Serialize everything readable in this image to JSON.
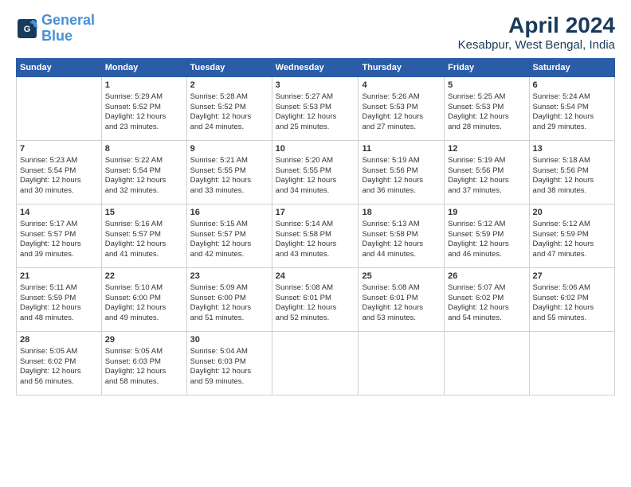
{
  "header": {
    "logo_line1": "General",
    "logo_line2": "Blue",
    "title": "April 2024",
    "subtitle": "Kesabpur, West Bengal, India"
  },
  "days_of_week": [
    "Sunday",
    "Monday",
    "Tuesday",
    "Wednesday",
    "Thursday",
    "Friday",
    "Saturday"
  ],
  "weeks": [
    [
      {
        "day": "",
        "detail": ""
      },
      {
        "day": "1",
        "detail": "Sunrise: 5:29 AM\nSunset: 5:52 PM\nDaylight: 12 hours\nand 23 minutes."
      },
      {
        "day": "2",
        "detail": "Sunrise: 5:28 AM\nSunset: 5:52 PM\nDaylight: 12 hours\nand 24 minutes."
      },
      {
        "day": "3",
        "detail": "Sunrise: 5:27 AM\nSunset: 5:53 PM\nDaylight: 12 hours\nand 25 minutes."
      },
      {
        "day": "4",
        "detail": "Sunrise: 5:26 AM\nSunset: 5:53 PM\nDaylight: 12 hours\nand 27 minutes."
      },
      {
        "day": "5",
        "detail": "Sunrise: 5:25 AM\nSunset: 5:53 PM\nDaylight: 12 hours\nand 28 minutes."
      },
      {
        "day": "6",
        "detail": "Sunrise: 5:24 AM\nSunset: 5:54 PM\nDaylight: 12 hours\nand 29 minutes."
      }
    ],
    [
      {
        "day": "7",
        "detail": "Sunrise: 5:23 AM\nSunset: 5:54 PM\nDaylight: 12 hours\nand 30 minutes."
      },
      {
        "day": "8",
        "detail": "Sunrise: 5:22 AM\nSunset: 5:54 PM\nDaylight: 12 hours\nand 32 minutes."
      },
      {
        "day": "9",
        "detail": "Sunrise: 5:21 AM\nSunset: 5:55 PM\nDaylight: 12 hours\nand 33 minutes."
      },
      {
        "day": "10",
        "detail": "Sunrise: 5:20 AM\nSunset: 5:55 PM\nDaylight: 12 hours\nand 34 minutes."
      },
      {
        "day": "11",
        "detail": "Sunrise: 5:19 AM\nSunset: 5:56 PM\nDaylight: 12 hours\nand 36 minutes."
      },
      {
        "day": "12",
        "detail": "Sunrise: 5:19 AM\nSunset: 5:56 PM\nDaylight: 12 hours\nand 37 minutes."
      },
      {
        "day": "13",
        "detail": "Sunrise: 5:18 AM\nSunset: 5:56 PM\nDaylight: 12 hours\nand 38 minutes."
      }
    ],
    [
      {
        "day": "14",
        "detail": "Sunrise: 5:17 AM\nSunset: 5:57 PM\nDaylight: 12 hours\nand 39 minutes."
      },
      {
        "day": "15",
        "detail": "Sunrise: 5:16 AM\nSunset: 5:57 PM\nDaylight: 12 hours\nand 41 minutes."
      },
      {
        "day": "16",
        "detail": "Sunrise: 5:15 AM\nSunset: 5:57 PM\nDaylight: 12 hours\nand 42 minutes."
      },
      {
        "day": "17",
        "detail": "Sunrise: 5:14 AM\nSunset: 5:58 PM\nDaylight: 12 hours\nand 43 minutes."
      },
      {
        "day": "18",
        "detail": "Sunrise: 5:13 AM\nSunset: 5:58 PM\nDaylight: 12 hours\nand 44 minutes."
      },
      {
        "day": "19",
        "detail": "Sunrise: 5:12 AM\nSunset: 5:59 PM\nDaylight: 12 hours\nand 46 minutes."
      },
      {
        "day": "20",
        "detail": "Sunrise: 5:12 AM\nSunset: 5:59 PM\nDaylight: 12 hours\nand 47 minutes."
      }
    ],
    [
      {
        "day": "21",
        "detail": "Sunrise: 5:11 AM\nSunset: 5:59 PM\nDaylight: 12 hours\nand 48 minutes."
      },
      {
        "day": "22",
        "detail": "Sunrise: 5:10 AM\nSunset: 6:00 PM\nDaylight: 12 hours\nand 49 minutes."
      },
      {
        "day": "23",
        "detail": "Sunrise: 5:09 AM\nSunset: 6:00 PM\nDaylight: 12 hours\nand 51 minutes."
      },
      {
        "day": "24",
        "detail": "Sunrise: 5:08 AM\nSunset: 6:01 PM\nDaylight: 12 hours\nand 52 minutes."
      },
      {
        "day": "25",
        "detail": "Sunrise: 5:08 AM\nSunset: 6:01 PM\nDaylight: 12 hours\nand 53 minutes."
      },
      {
        "day": "26",
        "detail": "Sunrise: 5:07 AM\nSunset: 6:02 PM\nDaylight: 12 hours\nand 54 minutes."
      },
      {
        "day": "27",
        "detail": "Sunrise: 5:06 AM\nSunset: 6:02 PM\nDaylight: 12 hours\nand 55 minutes."
      }
    ],
    [
      {
        "day": "28",
        "detail": "Sunrise: 5:05 AM\nSunset: 6:02 PM\nDaylight: 12 hours\nand 56 minutes."
      },
      {
        "day": "29",
        "detail": "Sunrise: 5:05 AM\nSunset: 6:03 PM\nDaylight: 12 hours\nand 58 minutes."
      },
      {
        "day": "30",
        "detail": "Sunrise: 5:04 AM\nSunset: 6:03 PM\nDaylight: 12 hours\nand 59 minutes."
      },
      {
        "day": "",
        "detail": ""
      },
      {
        "day": "",
        "detail": ""
      },
      {
        "day": "",
        "detail": ""
      },
      {
        "day": "",
        "detail": ""
      }
    ]
  ]
}
